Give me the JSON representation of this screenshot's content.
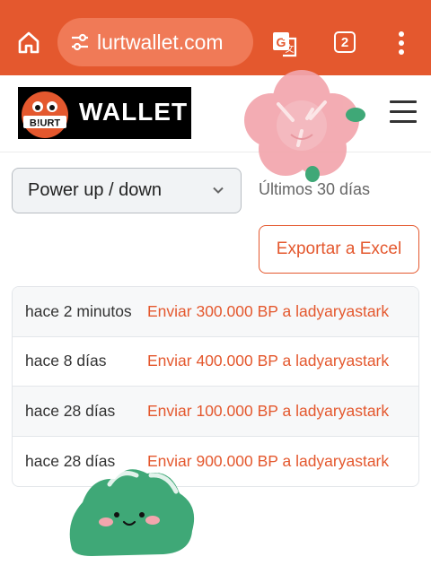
{
  "browser": {
    "url": "blurtwallet.com",
    "url_display": "lurtwallet.com",
    "tab_count": "2",
    "toolbar_color": "#e4582e"
  },
  "site": {
    "logo_badge": "B!URT",
    "logo_text": "WALLET"
  },
  "filters": {
    "operation_type": "Power up / down",
    "period": "Últimos 30 días",
    "export_label": "Exportar a Excel"
  },
  "transactions": [
    {
      "time": "hace 2 minutos",
      "description": "Enviar 300.000 BP a ladyaryastark"
    },
    {
      "time": "hace 8 días",
      "description": "Enviar 400.000 BP a ladyaryastark"
    },
    {
      "time": "hace 28 días",
      "description": "Enviar 100.000 BP a ladyaryastark"
    },
    {
      "time": "hace 28 días",
      "description": "Enviar 900.000 BP a ladyaryastark"
    }
  ],
  "colors": {
    "accent": "#e4582e",
    "sticker_pink": "#f2a6ad",
    "sticker_green": "#3fa877"
  }
}
